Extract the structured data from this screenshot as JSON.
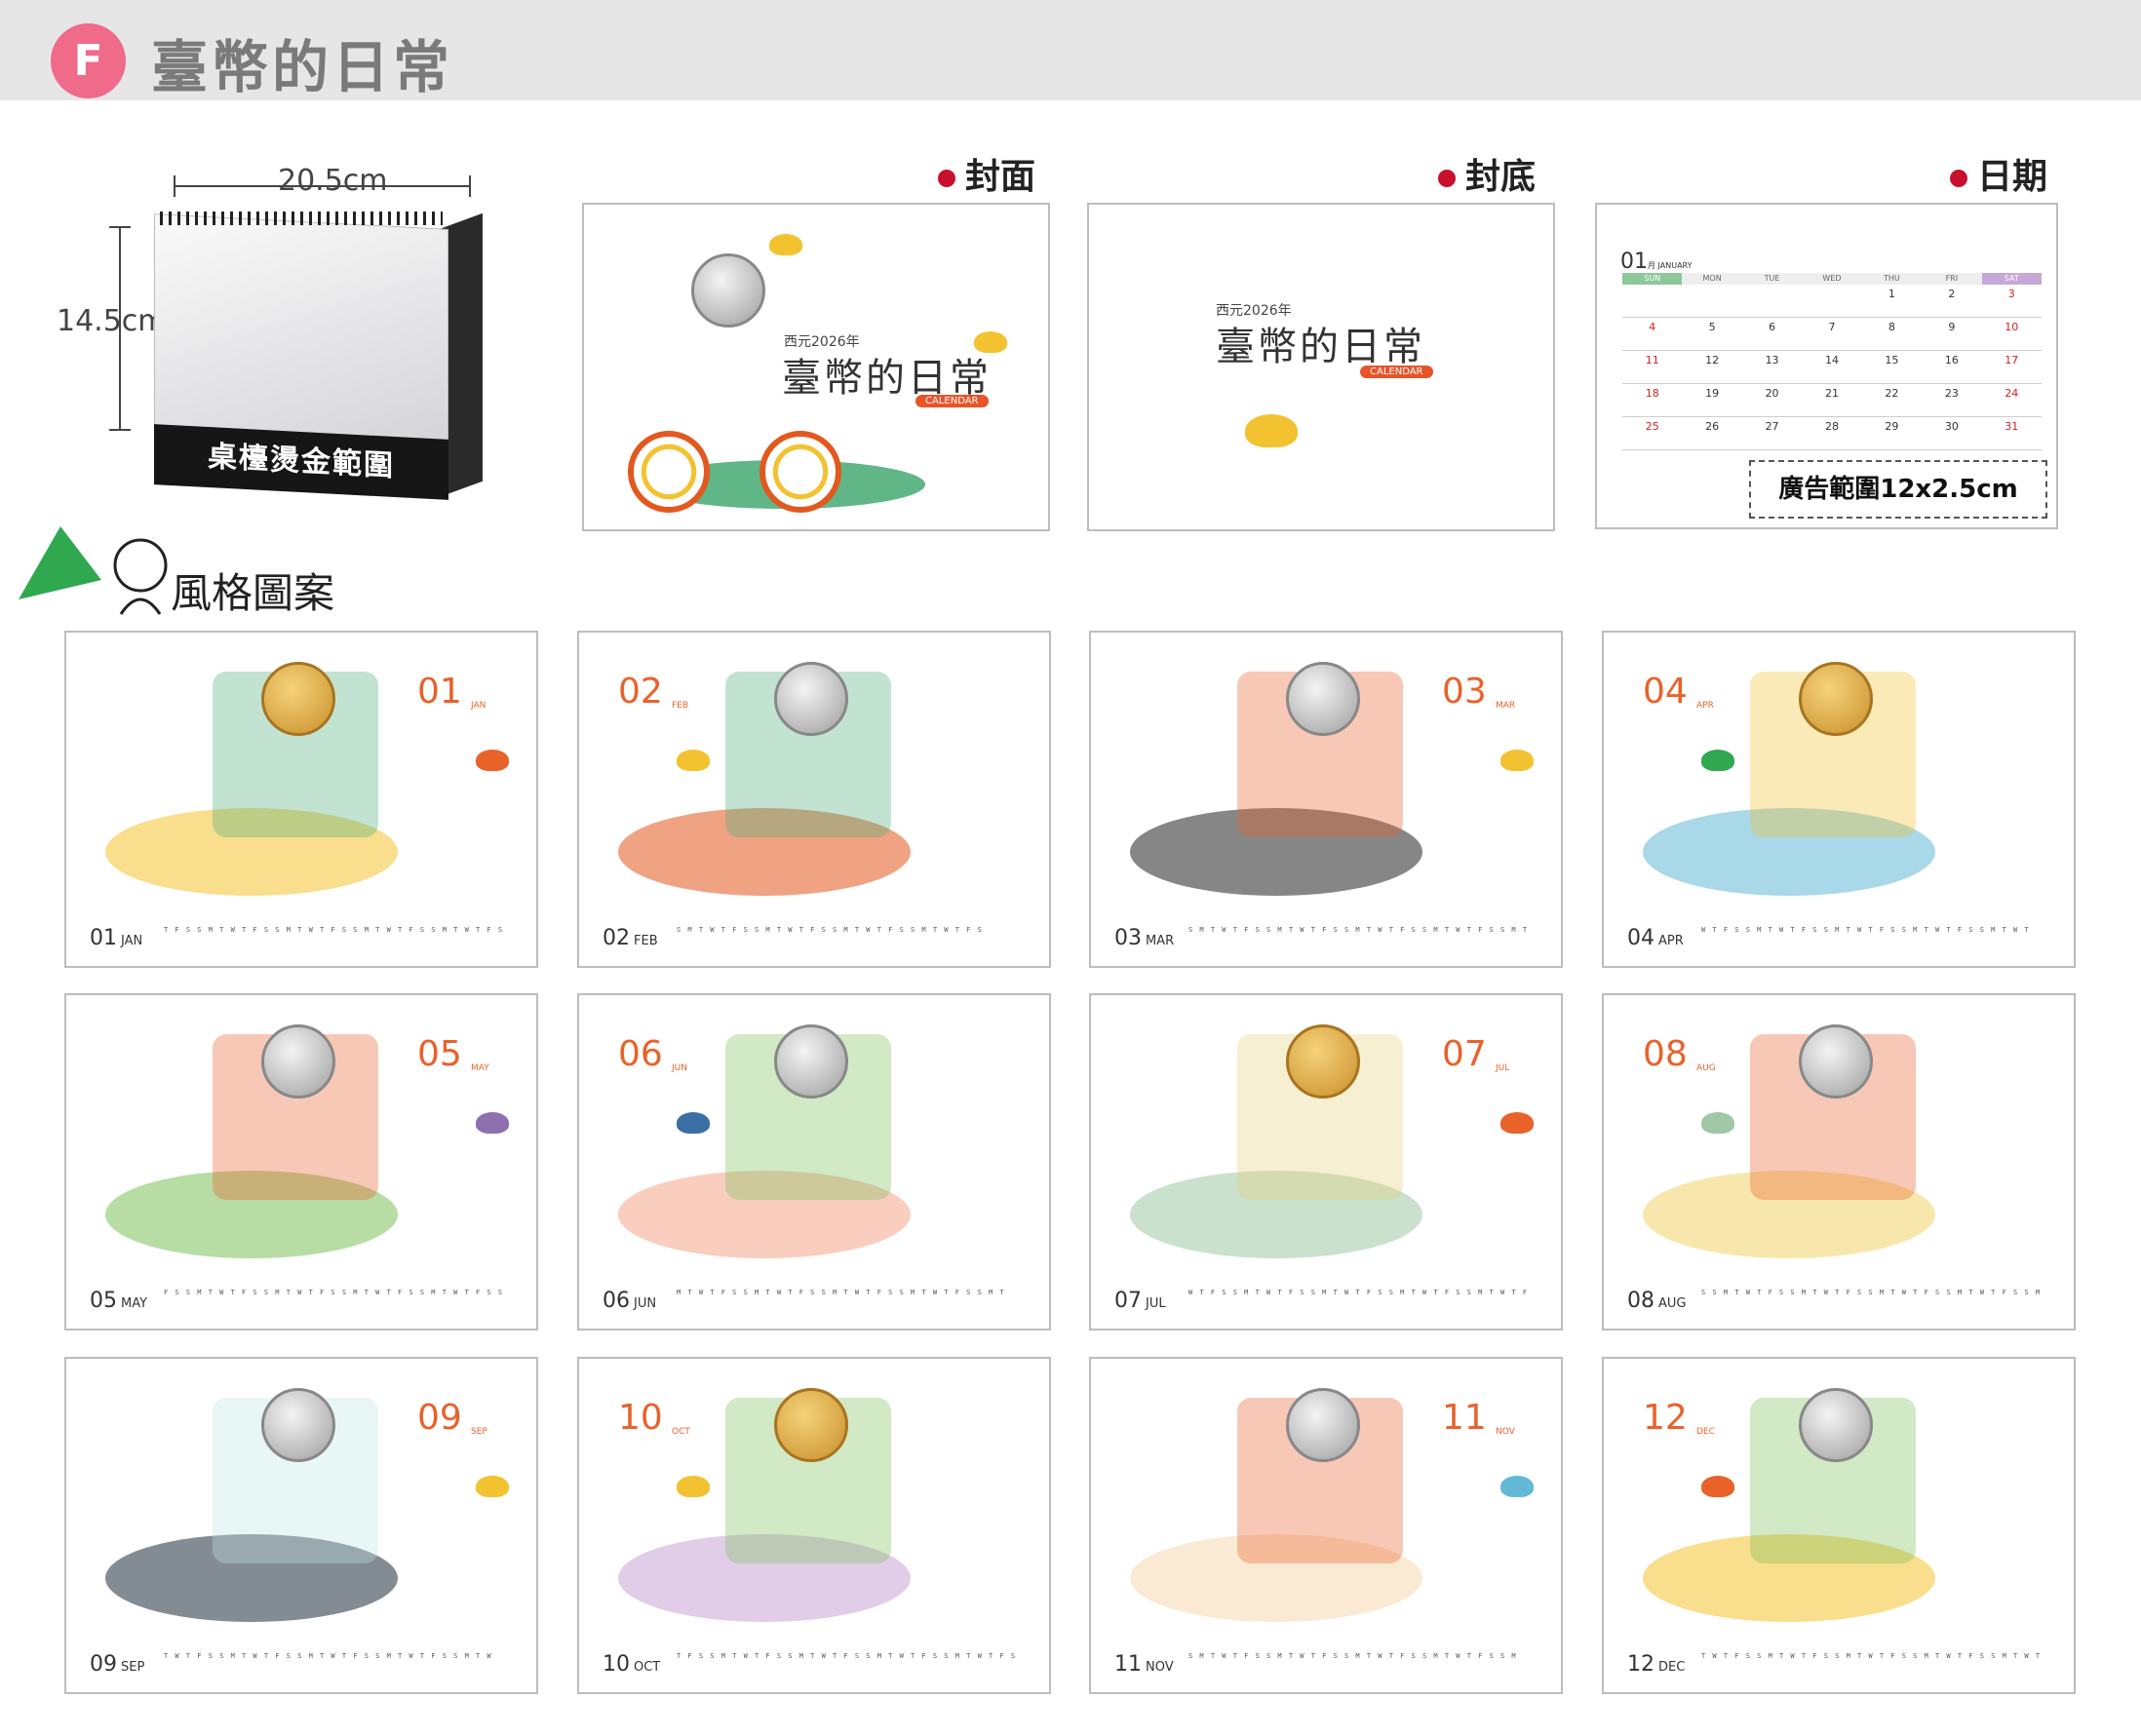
{
  "header": {
    "badge": "F",
    "title": "臺幣的日常"
  },
  "product": {
    "width_label": "20.5cm",
    "height_label": "14.5cm",
    "band_label": "桌檯燙金範圍"
  },
  "sections": {
    "cover": "封面",
    "back": "封底",
    "date": "日期",
    "style": "風格圖案"
  },
  "cover": {
    "year_text": "西元2026年",
    "title": "臺幣的日常",
    "tag": "CALENDAR"
  },
  "back": {
    "year_text": "西元2026年",
    "title": "臺幣的日常",
    "tag": "CALENDAR"
  },
  "date_sample": {
    "month_num": "01",
    "month_name": "月 JANUARY",
    "weekdays": [
      "SUN",
      "MON",
      "TUE",
      "WED",
      "THU",
      "FRI",
      "SAT"
    ],
    "days": [
      "",
      "",
      "",
      "",
      "1",
      "2",
      "3",
      "4",
      "5",
      "6",
      "7",
      "8",
      "9",
      "10",
      "11",
      "12",
      "13",
      "14",
      "15",
      "16",
      "17",
      "18",
      "19",
      "20",
      "21",
      "22",
      "23",
      "24",
      "25",
      "26",
      "27",
      "28",
      "29",
      "30",
      "31"
    ],
    "ad_label": "廣告範圍12x2.5cm"
  },
  "months": [
    {
      "num": "01",
      "abbr": "JAN",
      "foot": "01",
      "foot_abbr": "JAN",
      "strip": "T F S S M T W T F S S M T W T F S S M T W T F S S M T W T F S"
    },
    {
      "num": "02",
      "abbr": "FEB",
      "foot": "02",
      "foot_abbr": "FEB",
      "strip": "S M T W T F S S M T W T F S S M T W T F S S M T W T F S"
    },
    {
      "num": "03",
      "abbr": "MAR",
      "foot": "03",
      "foot_abbr": "MAR",
      "strip": "S M T W T F S S M T W T F S S M T W T F S S M T W T F S S M T"
    },
    {
      "num": "04",
      "abbr": "APR",
      "foot": "04",
      "foot_abbr": "APR",
      "strip": "W T F S S M T W T F S S M T W T F S S M T W T F S S M T W T"
    },
    {
      "num": "05",
      "abbr": "MAY",
      "foot": "05",
      "foot_abbr": "MAY",
      "strip": "F S S M T W T F S S M T W T F S S M T W T F S S M T W T F S S"
    },
    {
      "num": "06",
      "abbr": "JUN",
      "foot": "06",
      "foot_abbr": "JUN",
      "strip": "M T W T F S S M T W T F S S M T W T F S S M T W T F S S M T"
    },
    {
      "num": "07",
      "abbr": "JUL",
      "foot": "07",
      "foot_abbr": "JUL",
      "strip": "W T F S S M T W T F S S M T W T F S S M T W T F S S M T W T F"
    },
    {
      "num": "08",
      "abbr": "AUG",
      "foot": "08",
      "foot_abbr": "AUG",
      "strip": "S S M T W T F S S M T W T F S S M T W T F S S M T W T F S S M"
    },
    {
      "num": "09",
      "abbr": "SEP",
      "foot": "09",
      "foot_abbr": "SEP",
      "strip": "T W T F S S M T W T F S S M T W T F S S M T W T F S S M T W"
    },
    {
      "num": "10",
      "abbr": "OCT",
      "foot": "10",
      "foot_abbr": "OCT",
      "strip": "T F S S M T W T F S S M T W T F S S M T W T F S S M T W T F S"
    },
    {
      "num": "11",
      "abbr": "NOV",
      "foot": "11",
      "foot_abbr": "NOV",
      "strip": "S M T W T F S S M T W T F S S M T W T F S S M T W T F S S M"
    },
    {
      "num": "12",
      "abbr": "DEC",
      "foot": "12",
      "foot_abbr": "DEC",
      "strip": "T W T F S S M T W T F S S M T W T F S S M T W T F S S M T W T"
    }
  ]
}
